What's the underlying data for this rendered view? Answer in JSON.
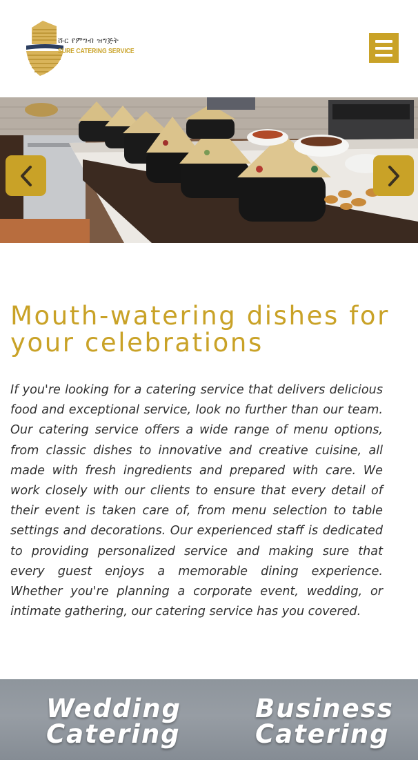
{
  "header": {
    "logo_amharic": "ሹር የምግብ ዝግጅት",
    "logo_name": "SURE CATERING SERVICE",
    "menu_icon": "hamburger-menu-icon",
    "accent_color": "#c9a227"
  },
  "hero": {
    "prev_icon": "chevron-left-icon",
    "next_icon": "chevron-right-icon"
  },
  "main": {
    "heading": "Mouth-watering dishes for your celebrations",
    "paragraph": "If you're looking for a catering service that delivers delicious food and exceptional service, look no further than our team. Our catering service offers a wide range of menu options, from classic dishes to innovative and creative cuisine, all made with fresh ingredients and prepared with care. We work closely with our clients to ensure that every detail of their event is taken care of, from menu selection to table settings and decorations. Our experienced staff is dedicated to providing personalized service and making sure that every guest enjoys a memorable dining experience. Whether you're planning a corporate event, wedding, or intimate gathering, our catering service has you covered."
  },
  "categories": [
    {
      "line1": "Wedding",
      "line2": "Catering"
    },
    {
      "line1": "Business",
      "line2": "Catering"
    }
  ]
}
